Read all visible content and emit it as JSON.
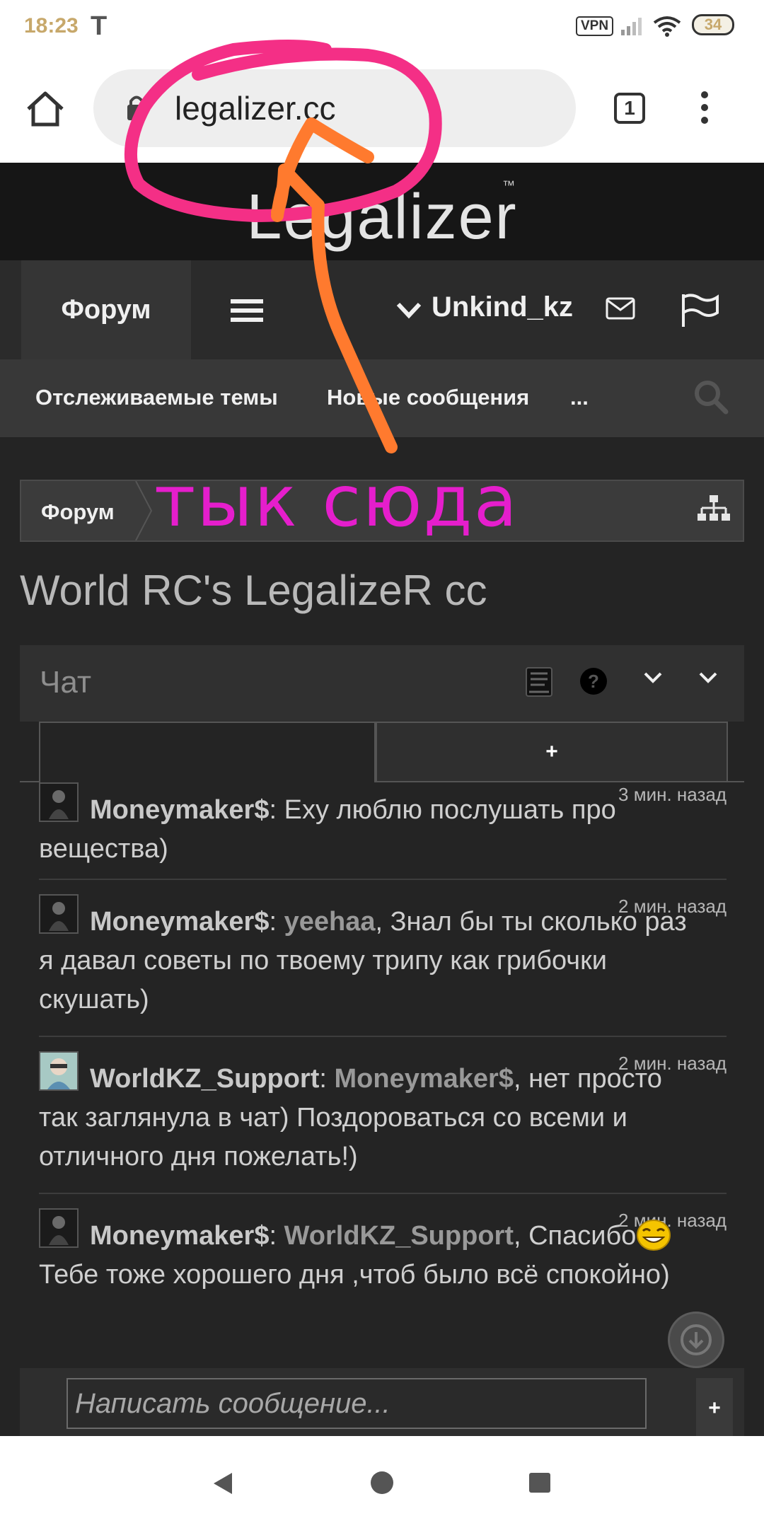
{
  "status_bar": {
    "time": "18:23",
    "carrier_icon": "T",
    "vpn": "VPN",
    "battery": "34"
  },
  "browser": {
    "url": "legalizer.cc",
    "tab_count": "1"
  },
  "site": {
    "logo": "Legalizer",
    "logo_tm": "™"
  },
  "nav": {
    "forum": "Форум",
    "username": "Unkind_kz"
  },
  "subnav": {
    "items": [
      "Отслеживаемые темы",
      "Новые сообщения",
      "..."
    ]
  },
  "breadcrumb": {
    "forum": "Форум"
  },
  "annotation": {
    "text": "тык сюда"
  },
  "page": {
    "title": "World RC's LegalizeR cc"
  },
  "chat": {
    "title": "Чат",
    "tab_plus": "+",
    "messages": [
      {
        "author": "Moneymaker$",
        "sep": ": ",
        "mention": "",
        "mention_sep": "",
        "text": "Еху люблю послушать про вещества)",
        "time": "3 мин. назад"
      },
      {
        "author": "Moneymaker$",
        "sep": ": ",
        "mention": "yeehaa",
        "mention_sep": ", ",
        "text": "Знал бы ты сколько раз я давал советы по твоему трипу как грибочки скушать)",
        "time": "2 мин. назад"
      },
      {
        "author": "WorldKZ_Support",
        "sep": ": ",
        "mention": "Moneymaker$",
        "mention_sep": ", ",
        "text": "нет просто так заглянула в чат) Поздороваться со всеми и отличного дня пожелать!)",
        "time": "2 мин. назад"
      },
      {
        "author": "Moneymaker$",
        "sep": ": ",
        "mention": "WorldKZ_Support",
        "mention_sep": ", ",
        "text_before": "Спасибо",
        "text_after": "Тебе тоже хорошего дня ,чтоб было всё спокойно)",
        "time": "2 мин. назад"
      }
    ],
    "input_placeholder": "Написать сообщение...",
    "send": "+"
  },
  "colors": {
    "annotation_pink": "#e51ecc",
    "annotation_orange": "#ff7a2e",
    "background": "#242424"
  }
}
